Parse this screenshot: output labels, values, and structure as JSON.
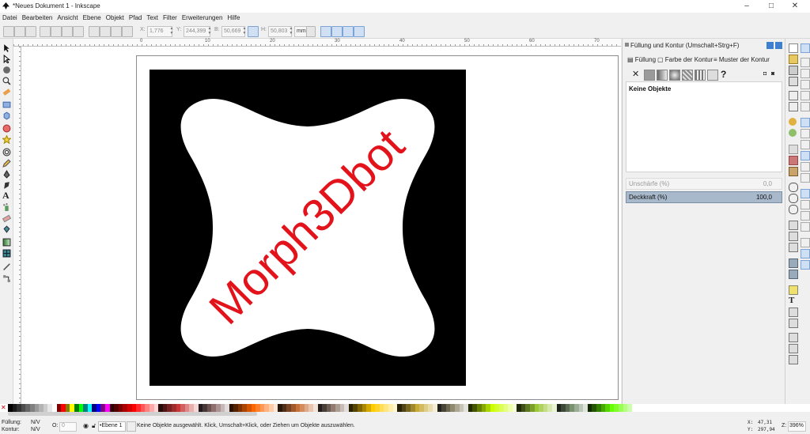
{
  "window": {
    "title": "*Neues Dokument 1 - Inkscape"
  },
  "menu": [
    "Datei",
    "Bearbeiten",
    "Ansicht",
    "Ebene",
    "Objekt",
    "Pfad",
    "Text",
    "Filter",
    "Erweiterungen",
    "Hilfe"
  ],
  "controls": {
    "x_label": "X:",
    "x_value": "1,776",
    "y_label": "Y:",
    "y_value": "244,399",
    "w_label": "B:",
    "w_value": "50,669",
    "h_label": "H:",
    "h_value": "50,803",
    "unit": "mm"
  },
  "ruler_labels": [
    "0",
    "10",
    "20",
    "30",
    "40",
    "50",
    "60",
    "70"
  ],
  "canvas": {
    "art_text": "Morph3Dbot",
    "art_text_color": "#e3131b",
    "background_color": "#000000",
    "shape_color": "#ffffff"
  },
  "dialog": {
    "title": "Füllung und Kontur (Umschalt+Strg+F)",
    "tabs": [
      "Füllung",
      "Farbe der Kontur",
      "Muster der Kontur"
    ],
    "no_objects": "Keine Objekte",
    "help_glyph": "?",
    "blur_label": "Unschärfe (%)",
    "blur_value": "0,0",
    "opacity_label": "Deckkraft (%)",
    "opacity_value": "100,0"
  },
  "status": {
    "fill_label": "Füllung:",
    "fill_value": "N/V",
    "stroke_label": "Kontur:",
    "stroke_value": "N/V",
    "opacity_short": "O:",
    "opacity_short_value": "0",
    "layer": "•Ebene 1",
    "message": "Keine Objekte ausgewählt. Klick, Umschalt+Klick, oder Ziehen um Objekte auszuwählen.",
    "x_label": "X:",
    "x_value": "47,31",
    "y_label": "Y:",
    "y_value": "297,94",
    "zoom_label": "Z:",
    "zoom_value": "396%"
  },
  "palette_colors": [
    "#000000",
    "#1a1a1a",
    "#333333",
    "#4d4d4d",
    "#666666",
    "#808080",
    "#999999",
    "#b3b3b3",
    "#cccccc",
    "#e6e6e6",
    "#ffffff",
    "#800000",
    "#ff0000",
    "#808000",
    "#ffff00",
    "#008000",
    "#00ff00",
    "#008080",
    "#00ffff",
    "#000080",
    "#0000ff",
    "#800080",
    "#ff00ff",
    "#2b0000",
    "#550000",
    "#800000",
    "#aa0000",
    "#d40000",
    "#ff0000",
    "#ff2a2a",
    "#ff5555",
    "#ff8080",
    "#ffaaaa",
    "#ffd5d5",
    "#280b0b",
    "#501616",
    "#782121",
    "#a02c2c",
    "#c83737",
    "#d35f5f",
    "#de8787",
    "#e9afaf",
    "#f4d7d7",
    "#241c1c",
    "#483737",
    "#6c5353",
    "#916f6f",
    "#ac9393",
    "#c8b7b7",
    "#e3dbdb",
    "#2b1100",
    "#552200",
    "#803300",
    "#aa4400",
    "#d45500",
    "#ff6600",
    "#ff7f2a",
    "#ff9955",
    "#ffb380",
    "#ffccaa",
    "#ffe6d5",
    "#28170b",
    "#502d16",
    "#784421",
    "#a05a2c",
    "#c87137",
    "#d38d5f",
    "#deaa87",
    "#e9c6af",
    "#f4e3d7",
    "#241f1c",
    "#483e37",
    "#6c5d53",
    "#917c6f",
    "#ac9d93",
    "#c8beb7",
    "#e3dedb",
    "#2b2200",
    "#554400",
    "#806600",
    "#aa8800",
    "#d4aa00",
    "#ffcc00",
    "#ffd42a",
    "#ffdd55",
    "#ffe680",
    "#ffeeaa",
    "#fff6d5",
    "#28220b",
    "#504416",
    "#786721",
    "#a0892c",
    "#c8ab37",
    "#d3bc5f",
    "#decd87",
    "#e9ddaf",
    "#f4eed7",
    "#24221c",
    "#484537",
    "#6c6753",
    "#918a6f",
    "#aca793",
    "#c8c4b7",
    "#e3e2db",
    "#222b00",
    "#445500",
    "#668000",
    "#88aa00",
    "#aad400",
    "#ccff00",
    "#d4ff2a",
    "#ddff55",
    "#e5ff80",
    "#eeffaa",
    "#f6ffd5",
    "#1f280b",
    "#3e5016",
    "#5d7821",
    "#7ca02c",
    "#9cc837",
    "#b0d35f",
    "#c4de87",
    "#d7e9af",
    "#ebf4d7",
    "#1f241c",
    "#3e4837",
    "#5a6c53",
    "#7a916f",
    "#9aac93",
    "#bcc8b7",
    "#dee3db",
    "#112b00",
    "#225500",
    "#338000",
    "#44aa00",
    "#55d400",
    "#66ff00",
    "#7fff2a",
    "#99ff55",
    "#b3ff80",
    "#ccffaa"
  ]
}
